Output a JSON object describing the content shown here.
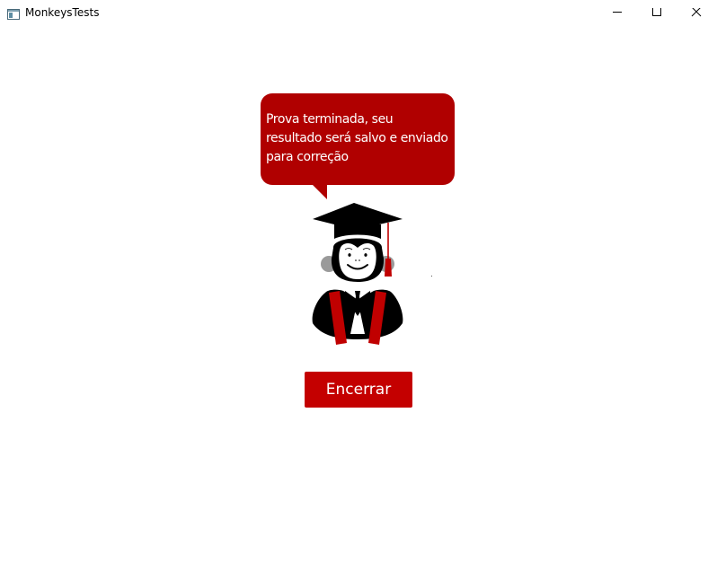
{
  "window": {
    "title": "MonkeysTests",
    "app_icon": "window-app-icon",
    "controls": {
      "minimize_icon": "minimize-icon",
      "maximize_icon": "maximize-icon",
      "close_icon": "close-icon"
    }
  },
  "main": {
    "message": "Prova terminada, seu resultado será salvo e enviado para correção",
    "mascot": "graduate-monkey-icon",
    "end_button_label": "Encerrar"
  },
  "colors": {
    "bubble": "#b00000",
    "button": "#c40000",
    "text_on_accent": "#ffffff"
  }
}
